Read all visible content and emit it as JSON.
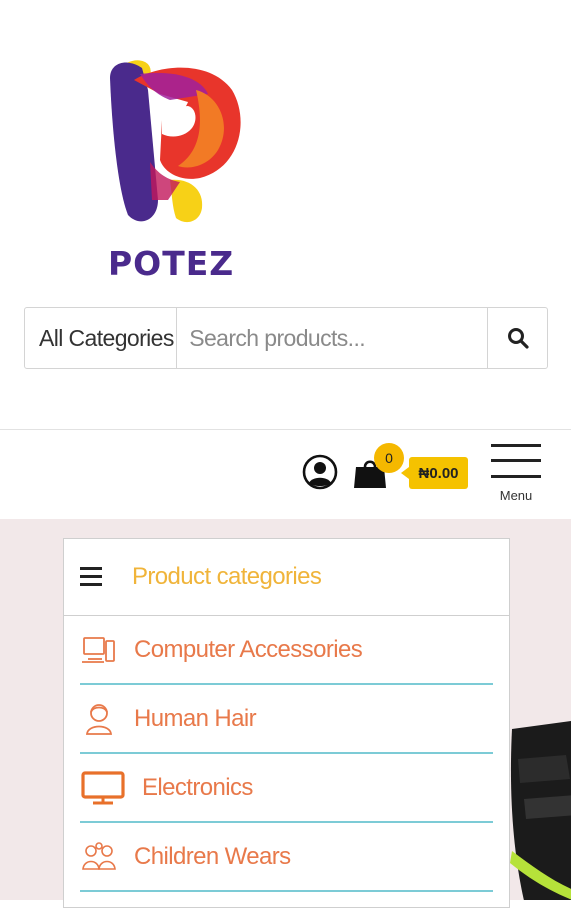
{
  "brand": {
    "name": "POTEZ",
    "colors": {
      "purple": "#4a2a8c",
      "red": "#e8352b",
      "orange": "#f27a25",
      "yellow": "#f7d117"
    }
  },
  "search": {
    "category_selected": "All Categories",
    "placeholder": "Search products...",
    "value": "",
    "button_icon": "search-icon"
  },
  "header": {
    "account_icon": "user-circle-icon",
    "cart_icon": "shopping-bag-icon",
    "cart_count": "0",
    "cart_total": "₦0.00",
    "menu_label": "Menu"
  },
  "categories": {
    "title": "Product categories",
    "items": [
      {
        "label": "Computer Accessories",
        "icon": "computer-icon"
      },
      {
        "label": "Human Hair",
        "icon": "person-icon"
      },
      {
        "label": "Electronics",
        "icon": "monitor-icon"
      },
      {
        "label": "Children Wears",
        "icon": "children-icon"
      }
    ]
  },
  "colors": {
    "accent_yellow": "#f5c200",
    "category_text": "#e8794a",
    "category_title": "#f0b43a",
    "divider": "#7ccbd6",
    "hero_bg": "#f2e8e9"
  }
}
